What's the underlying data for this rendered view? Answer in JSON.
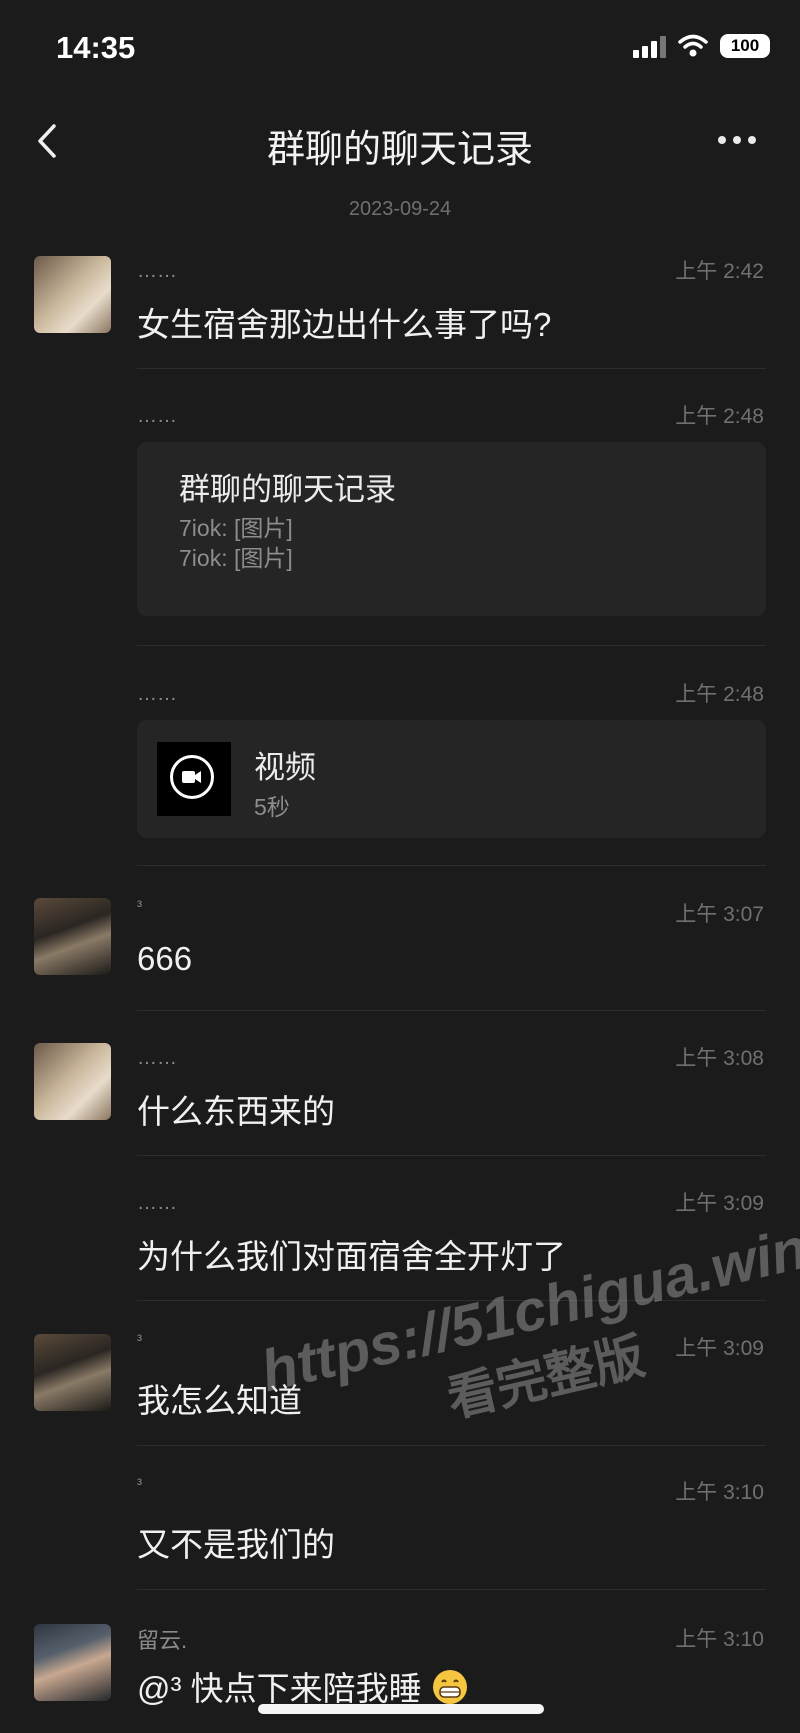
{
  "status_bar": {
    "time": "14:35",
    "battery": "100"
  },
  "nav": {
    "title": "群聊的聊天记录"
  },
  "date_header": "2023-09-24",
  "messages": [
    {
      "sender": "……",
      "time": "上午 2:42",
      "text": "女生宿舍那边出什么事了吗?"
    },
    {
      "sender": "……",
      "time": "上午 2:48",
      "card_title": "群聊的聊天记录",
      "lines": [
        "7iok: [图片]",
        "7iok: [图片]"
      ]
    },
    {
      "sender": "……",
      "time": "上午 2:48",
      "video_label": "视频",
      "video_duration": "5秒"
    },
    {
      "sender": "³",
      "time": "上午 3:07",
      "text": "666"
    },
    {
      "sender": "……",
      "time": "上午 3:08",
      "text": "什么东西来的"
    },
    {
      "sender": "……",
      "time": "上午 3:09",
      "text": "为什么我们对面宿舍全开灯了"
    },
    {
      "sender": "³",
      "time": "上午 3:09",
      "text": "我怎么知道"
    },
    {
      "sender": "³",
      "time": "上午 3:10",
      "text": "又不是我们的"
    },
    {
      "sender": "留云.",
      "time": "上午 3:10",
      "text": "@³ 快点下来陪我睡"
    }
  ],
  "watermark": {
    "url": "https://51chigua.win",
    "caption": "看完整版"
  },
  "icons": [
    "back-chevron-icon",
    "more-dots-icon",
    "video-camera-icon",
    "cellular-signal-icon",
    "wifi-icon",
    "grin-emoji-icon"
  ]
}
